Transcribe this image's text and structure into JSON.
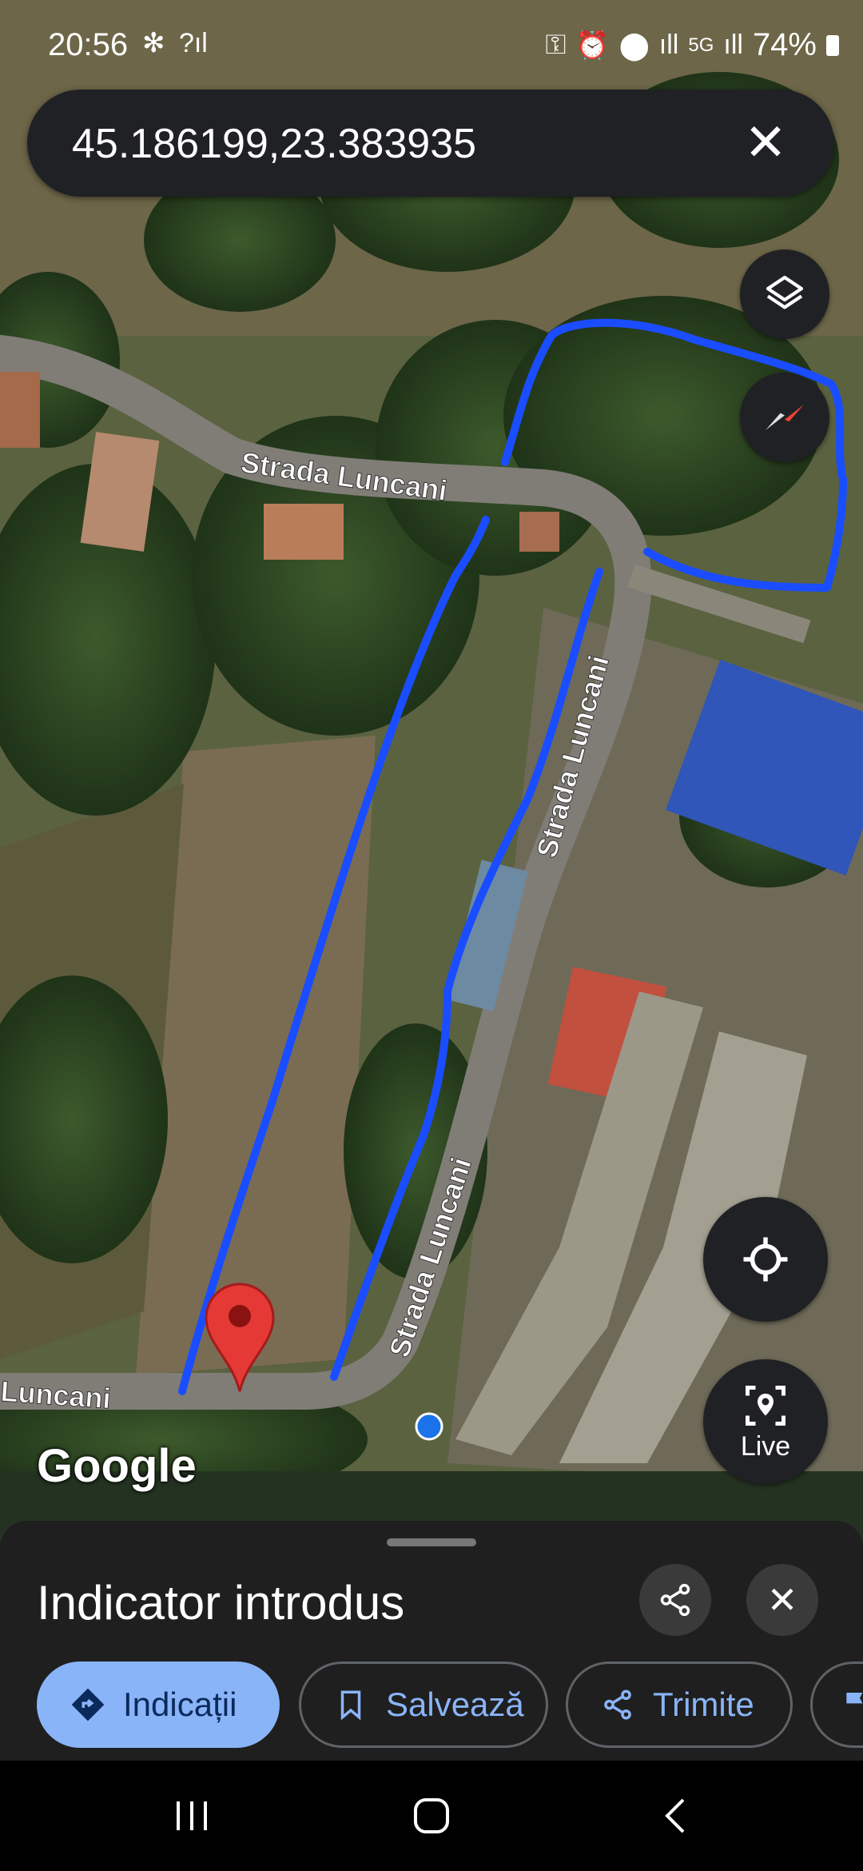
{
  "status_bar": {
    "time": "20:56",
    "battery": "74%",
    "icons": [
      "fan-icon",
      "wifi-calling-icon",
      "key-icon",
      "alarm-icon",
      "location-icon",
      "signal-icon",
      "5g-icon",
      "signal-icon-2",
      "battery-icon"
    ]
  },
  "search": {
    "query": "45.186199,23.383935",
    "close_icon": "close-icon"
  },
  "map": {
    "street_labels": [
      "Strada Luncani",
      "Strada Luncani",
      "Strada Luncani",
      "Luncani"
    ],
    "attribution": "Google",
    "drawn_outline_color": "#1a4dff",
    "pin_color": "#e53935",
    "my_location_color": "#1a73e8"
  },
  "controls": {
    "layers_icon": "layers-icon",
    "compass_icon": "compass-icon",
    "my_location_icon": "my-location-icon",
    "live_label": "Live"
  },
  "sheet": {
    "title": "Indicator introdus",
    "share_icon": "share-icon",
    "close_icon": "close-icon",
    "actions": [
      {
        "label": "Indicații",
        "icon": "directions-icon"
      },
      {
        "label": "Salvează",
        "icon": "bookmark-icon"
      },
      {
        "label": "Trimite",
        "icon": "share-icon"
      }
    ],
    "accent": "#8ab4f8"
  },
  "nav_bar": {
    "icons": [
      "recents-icon",
      "home-icon",
      "back-icon"
    ]
  }
}
